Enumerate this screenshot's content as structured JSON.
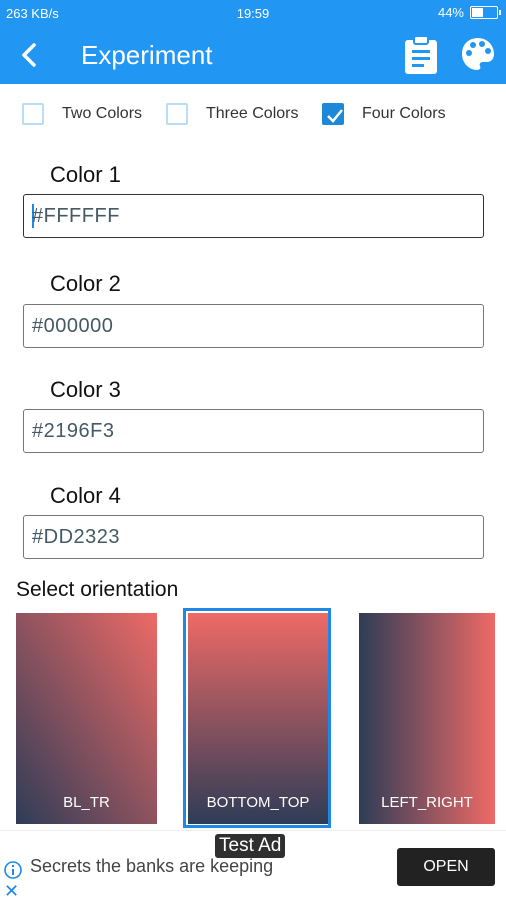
{
  "status": {
    "network": "263 KB/s",
    "time": "19:59",
    "battery": "44%",
    "battery_level": 0.44
  },
  "appbar": {
    "title": "Experiment",
    "back_icon": "back-arrow-icon",
    "clipboard_icon": "clipboard-icon",
    "palette_icon": "palette-icon"
  },
  "options": [
    {
      "label": "Two Colors",
      "checked": false
    },
    {
      "label": "Three Colors",
      "checked": false
    },
    {
      "label": "Four Colors",
      "checked": true
    }
  ],
  "colors": [
    {
      "label": "Color 1",
      "value": "#FFFFFF"
    },
    {
      "label": "Color 2",
      "value": "#000000"
    },
    {
      "label": "Color 3",
      "value": "#2196F3"
    },
    {
      "label": "Color 4",
      "value": "#DD2323"
    }
  ],
  "orientation": {
    "title": "Select orientation",
    "tiles": [
      {
        "label": "BL_TR",
        "selected": false
      },
      {
        "label": "BOTTOM_TOP",
        "selected": true
      },
      {
        "label": "LEFT_RIGHT",
        "selected": false
      }
    ]
  },
  "ad": {
    "badge": "Test Ad",
    "text": "Secrets the banks are keeping",
    "button": "OPEN"
  },
  "theme": {
    "primary": "#2196F3",
    "grad_start": "#2E3C57",
    "grad_end": "#EE6A66"
  }
}
